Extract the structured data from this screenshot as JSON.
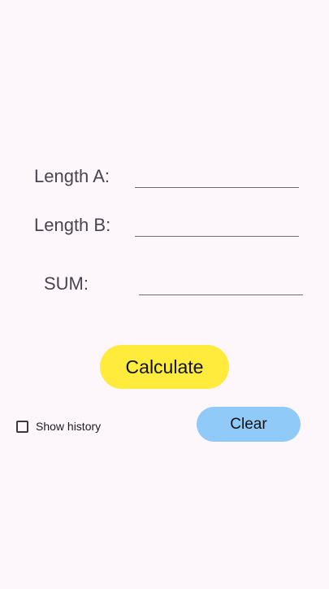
{
  "form": {
    "length_a": {
      "label": "Length A:",
      "value": "",
      "placeholder": ""
    },
    "length_b": {
      "label": "Length B:",
      "value": "",
      "placeholder": ""
    },
    "sum": {
      "label": "SUM:",
      "value": "",
      "placeholder": ""
    }
  },
  "actions": {
    "calculate_label": "Calculate",
    "clear_label": "Clear"
  },
  "options": {
    "show_history_label": "Show history",
    "show_history_checked": false
  },
  "colors": {
    "background": "#fdf7fc",
    "calculate_button": "#ffeb3b",
    "clear_button": "#90caf9",
    "label_text": "#49454f"
  }
}
